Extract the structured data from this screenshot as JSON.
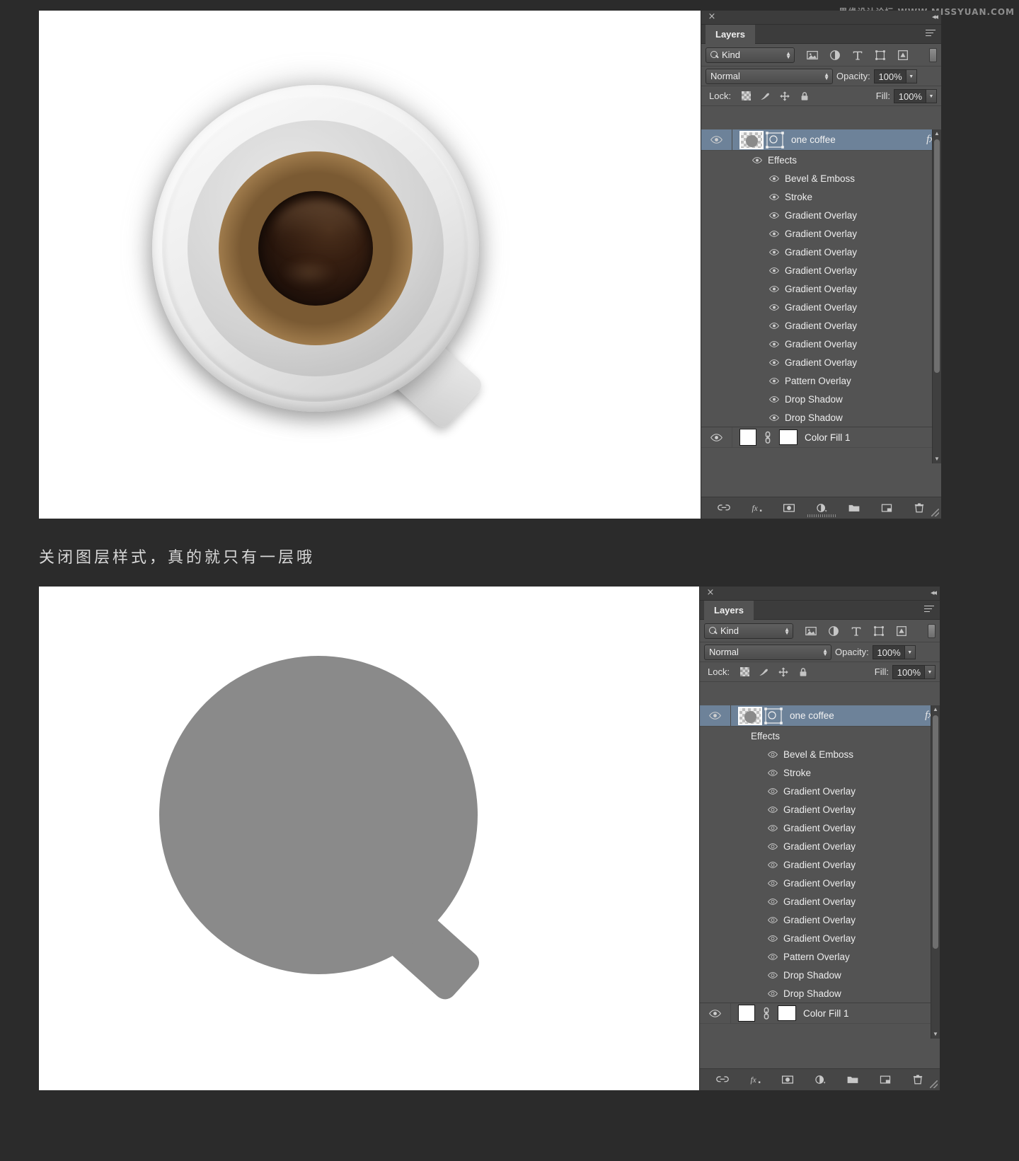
{
  "watermark": "思缘设计论坛  WWW.MISSYUAN.COM",
  "caption": "关闭图层样式，真的就只有一层哦",
  "panel": {
    "title": "Layers",
    "close_icon": "×",
    "collapse_icon": "«",
    "menu_icon": "panel-menu-icon",
    "filter": {
      "kind_label": "Kind",
      "search_icon": "search-icon",
      "stepper_icon": "stepper-arrows-icon",
      "icons": [
        "pixel-filter-icon",
        "adjustment-filter-icon",
        "type-filter-icon",
        "shape-filter-icon",
        "smart-object-filter-icon"
      ],
      "toggle_icon": "filter-toggle-icon"
    },
    "blend": {
      "mode": "Normal",
      "opacity_label": "Opacity:",
      "opacity_value": "100%"
    },
    "lock": {
      "label": "Lock:",
      "icons": [
        "lock-transparent-pixels-icon",
        "lock-image-pixels-icon",
        "lock-position-icon",
        "lock-all-icon"
      ],
      "fill_label": "Fill:",
      "fill_value": "100%"
    },
    "layers": [
      {
        "name": "one coffee",
        "selected": true,
        "fx": "fx",
        "visible": true,
        "type": "shape"
      },
      {
        "name": "Color Fill 1",
        "selected": false,
        "visible": true,
        "type": "fill"
      }
    ],
    "effects_group_label": "Effects",
    "effects": [
      "Bevel & Emboss",
      "Stroke",
      "Gradient Overlay",
      "Gradient Overlay",
      "Gradient Overlay",
      "Gradient Overlay",
      "Gradient Overlay",
      "Gradient Overlay",
      "Gradient Overlay",
      "Gradient Overlay",
      "Gradient Overlay",
      "Pattern Overlay",
      "Drop Shadow",
      "Drop Shadow"
    ],
    "bottom_bar_icons": [
      "link-layers-icon",
      "add-layer-style-icon",
      "add-layer-mask-icon",
      "new-fill-adjustment-icon",
      "new-group-icon",
      "new-layer-icon",
      "delete-layer-icon"
    ]
  },
  "colors": {
    "panel_bg": "#535353",
    "selected_layer": "#6d8299",
    "page_bg": "#2b2b2b",
    "flat_shape": "#8a8a8a",
    "coffee": "#20110a"
  },
  "canvas": {
    "top_alt": "coffee cup top view rendered with layer styles",
    "bottom_alt": "flat grey cup silhouette with layer styles disabled"
  }
}
